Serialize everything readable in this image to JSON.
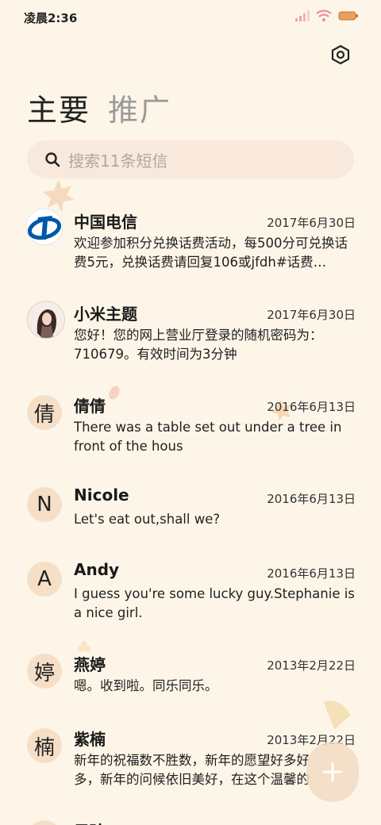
{
  "status": {
    "time": "凌晨2:36"
  },
  "tabs": [
    {
      "label": "主要"
    },
    {
      "label": "推广"
    }
  ],
  "search": {
    "placeholder": "搜索11条短信"
  },
  "conversations": [
    {
      "name": "中国电信",
      "date": "2017年6月30日",
      "preview": "欢迎参加积分兑换话费活动，每500分可兑换话费5元，兑换话费请回复106或jfdh#话费…",
      "avatar_type": "logo-icon"
    },
    {
      "name": "小米主题",
      "date": "2017年6月30日",
      "preview": "您好！您的网上营业厅登录的随机密码为：710679。有效时间为3分钟",
      "avatar_type": "photo"
    },
    {
      "name": "倩倩",
      "date": "2016年6月13日",
      "preview": "There was a table set out under a tree in front of the hous",
      "avatar_letter": "倩"
    },
    {
      "name": "Nicole",
      "date": "2016年6月13日",
      "preview": "Let's eat out,shall we?",
      "avatar_letter": "N"
    },
    {
      "name": "Andy",
      "date": "2016年6月13日",
      "preview": "I guess you're some lucky guy.Stephanie is a nice girl.",
      "avatar_letter": "A"
    },
    {
      "name": "燕婷",
      "date": "2013年2月22日",
      "preview": "嗯。收到啦。同乐同乐。",
      "avatar_letter": "婷"
    },
    {
      "name": "紫楠",
      "date": "2013年2月22日",
      "preview": "新年的祝福数不胜数，新年的愿望好多好多，新年的问候依旧美好，在这个温馨的时刻",
      "avatar_letter": "楠"
    },
    {
      "name": "子玲",
      "date": "",
      "preview": "",
      "avatar_letter": "玲"
    }
  ],
  "colors": {
    "background": "#fdf6e8",
    "search_bg": "#f8e9dc",
    "avatar_bg": "#f5e0c7",
    "fab_bg": "#f3dbc3",
    "telecom_blue": "#0057a8"
  }
}
